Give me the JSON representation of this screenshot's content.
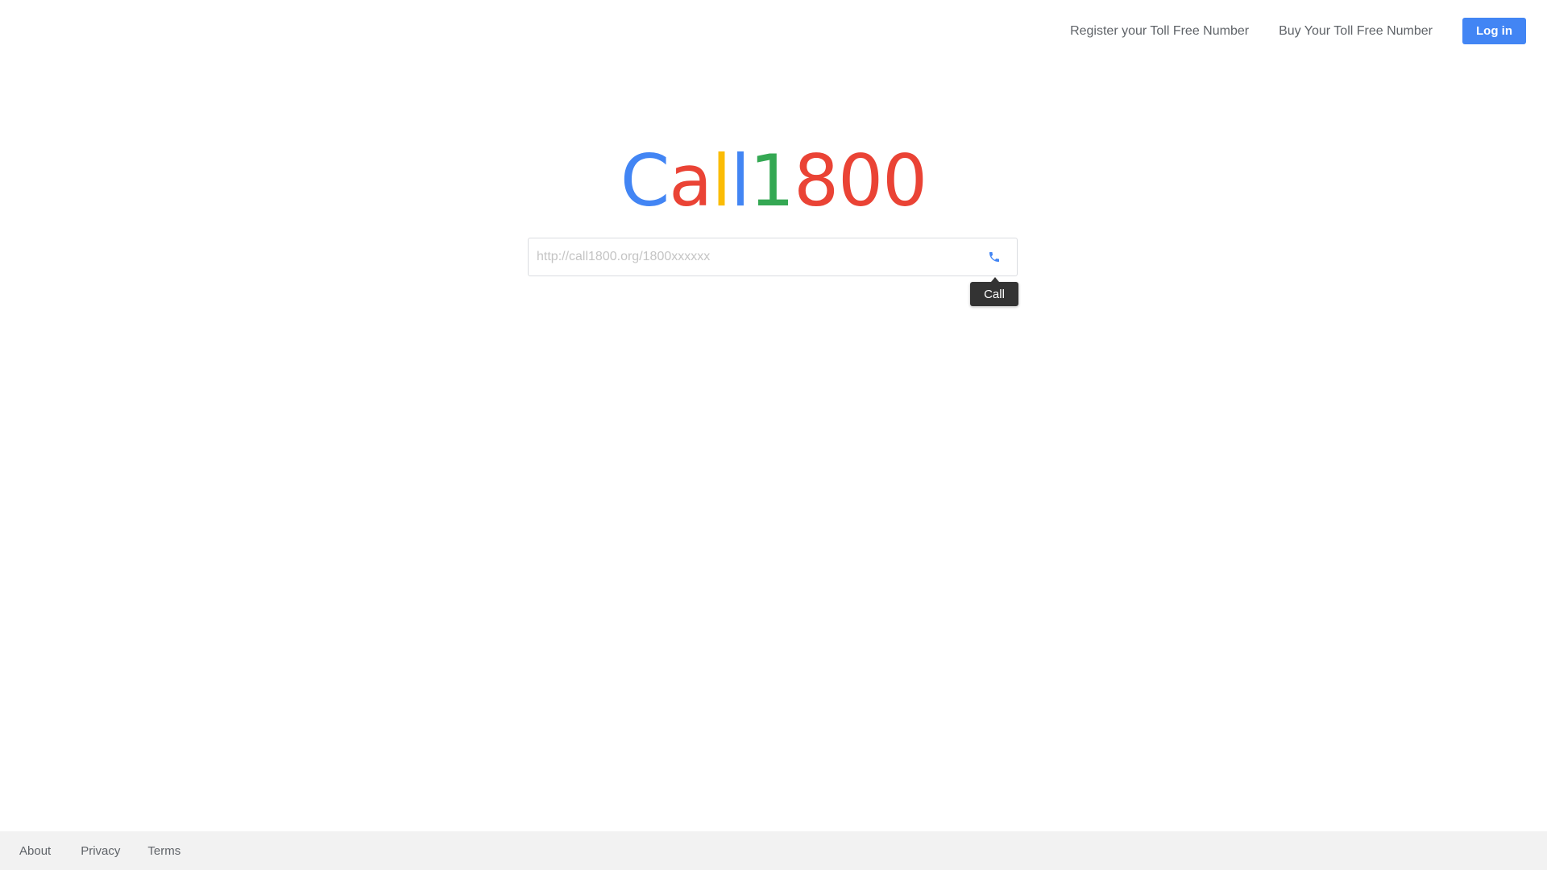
{
  "topnav": {
    "register_label": "Register your Toll Free Number",
    "buy_label": "Buy Your Toll Free Number",
    "login_label": "Log in"
  },
  "logo": {
    "letters": [
      {
        "char": "C",
        "color": "#4285f4"
      },
      {
        "char": "a",
        "color": "#ea4335"
      },
      {
        "char": "l",
        "color": "#fbbc05"
      },
      {
        "char": "l",
        "color": "#4285f4"
      },
      {
        "char": "1",
        "color": "#34a853"
      },
      {
        "char": "8",
        "color": "#ea4335"
      },
      {
        "char": "0",
        "color": "#ea4335"
      },
      {
        "char": "0",
        "color": "#ea4335"
      }
    ]
  },
  "search": {
    "placeholder": "http://call1800.org/1800xxxxxx",
    "value": "",
    "button_icon": "phone-icon",
    "tooltip": "Call"
  },
  "footer": {
    "about_label": "About",
    "privacy_label": "Privacy",
    "terms_label": "Terms"
  },
  "colors": {
    "accent": "#4285f4",
    "tooltip_bg": "#333333",
    "footer_bg": "#f2f2f2"
  }
}
